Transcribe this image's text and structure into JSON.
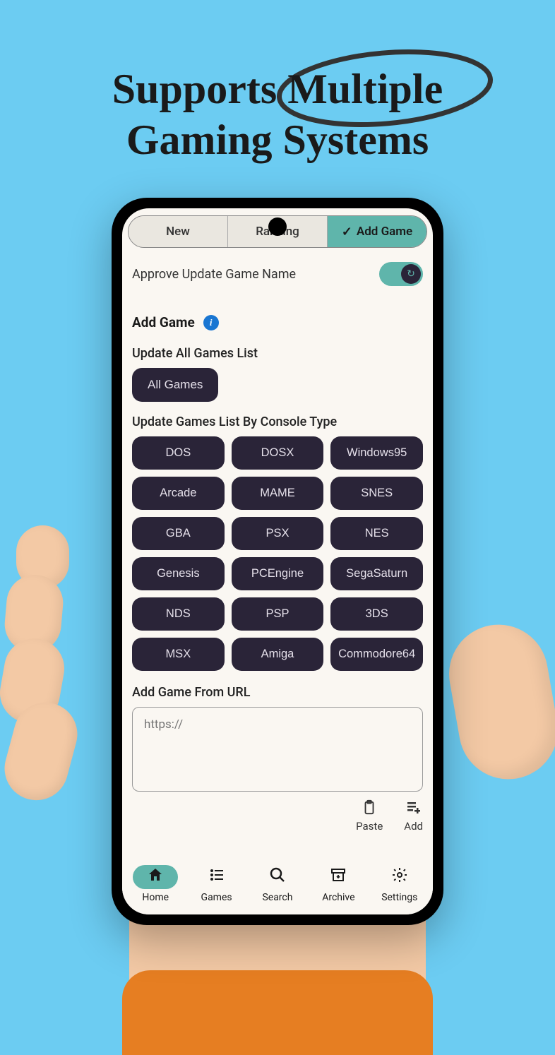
{
  "headline": {
    "line1": "Supports Multiple",
    "line2": "Gaming Systems"
  },
  "tabs": {
    "items": [
      {
        "label": "New",
        "active": false
      },
      {
        "label": "Ranking",
        "active": false
      },
      {
        "label": "Add Game",
        "active": true
      }
    ]
  },
  "approve": {
    "label": "Approve Update Game Name",
    "toggle_icon": "↻"
  },
  "section": {
    "title": "Add Game",
    "info_glyph": "i"
  },
  "update_all": {
    "heading": "Update All Games List",
    "button": "All Games"
  },
  "by_console": {
    "heading": "Update Games List By Console Type",
    "items": [
      "DOS",
      "DOSX",
      "Windows95",
      "Arcade",
      "MAME",
      "SNES",
      "GBA",
      "PSX",
      "NES",
      "Genesis",
      "PCEngine",
      "SegaSaturn",
      "NDS",
      "PSP",
      "3DS",
      "MSX",
      "Amiga",
      "Commodore64"
    ]
  },
  "from_url": {
    "heading": "Add Game From URL",
    "placeholder": "https://",
    "paste_label": "Paste",
    "add_label": "Add"
  },
  "bottom_nav": {
    "items": [
      {
        "label": "Home",
        "active": true
      },
      {
        "label": "Games",
        "active": false
      },
      {
        "label": "Search",
        "active": false
      },
      {
        "label": "Archive",
        "active": false
      },
      {
        "label": "Settings",
        "active": false
      }
    ]
  },
  "colors": {
    "background": "#6cccf2",
    "accent": "#5fb5ab",
    "pill": "#2a2438",
    "screen": "#faf7f2"
  }
}
